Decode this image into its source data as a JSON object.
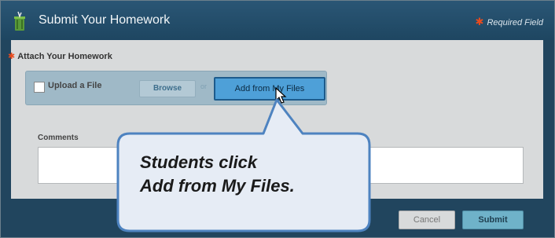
{
  "header": {
    "title": "Submit Your Homework",
    "required_note": "Required Field",
    "required_star": "✱"
  },
  "form": {
    "attach_label": "Attach Your Homework",
    "attach_star": "✱",
    "upload_checkbox_checked": false,
    "upload_label": "Upload a File",
    "browse_label": "Browse",
    "or_text": "or",
    "add_from_files_label": "Add from My Files",
    "comments_label": "Comments",
    "comments_value": ""
  },
  "actions": {
    "cancel_label": "Cancel",
    "submit_label": "Submit"
  },
  "callout": {
    "line1": "Students click",
    "line2": "Add from My Files."
  },
  "icons": {
    "title_icon": "trash-can-icon",
    "cursor": "mouse-pointer-icon"
  },
  "colors": {
    "header_bg": "#21455e",
    "required_star": "#e84b1e",
    "highlight_button": "#4ea0d8",
    "callout_border": "#4e83c0"
  }
}
